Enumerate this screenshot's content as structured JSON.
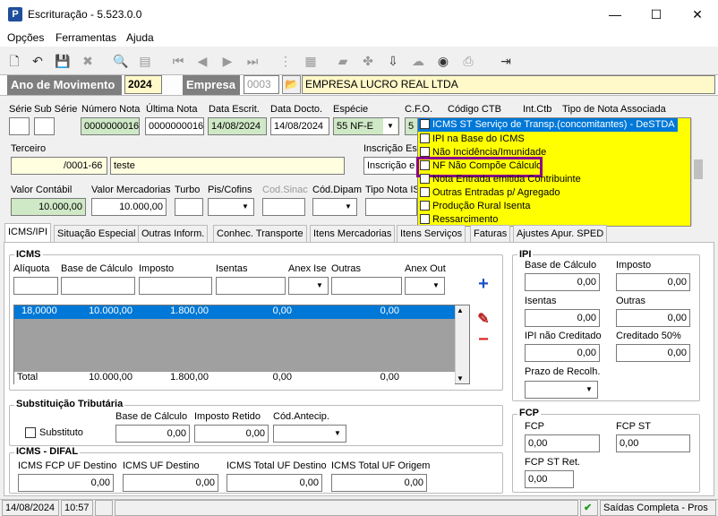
{
  "window": {
    "title": "Escrituração - 5.523.0.0",
    "minimize": "—",
    "maximize": "☐",
    "close": "✕"
  },
  "menu": [
    "Opções",
    "Ferramentas",
    "Ajuda"
  ],
  "header": {
    "ano_label": "Ano de Movimento",
    "ano_value": "2024",
    "empresa_label": "Empresa",
    "empresa_code": "0003",
    "empresa_name": "EMPRESA LUCRO REAL LTDA"
  },
  "doc": {
    "serie_label": "Série",
    "subserie_label": "Sub Série",
    "numero_label": "Número Nota",
    "numero_value": "0000000016",
    "ultima_label": "Última Nota",
    "ultima_value": "0000000016",
    "escrit_label": "Data Escrit.",
    "escrit_value": "14/08/2024",
    "docto_label": "Data Docto.",
    "docto_value": "14/08/2024",
    "especie_label": "Espécie",
    "especie_value": "55   NF-E",
    "cfo_label": "C.F.O.",
    "cfo_value": "5",
    "ctb_label": "Código CTB",
    "intctb_label": "Int.Ctb",
    "tiponota_label": "Tipo de Nota Associada"
  },
  "terceiro": {
    "label": "Terceiro",
    "cnpj": "/0001-66",
    "name": "teste",
    "inscricao_label": "Inscrição Es",
    "inscricao_value": "Inscrição e"
  },
  "valores": {
    "contabil_label": "Valor Contábil",
    "contabil_value": "10.000,00",
    "mercadorias_label": "Valor Mercadorias",
    "mercadorias_value": "10.000,00",
    "turbo_label": "Turbo",
    "piscofins_label": "Pis/Cofins",
    "codsinac_label": "Cod.Sinac",
    "coddipam_label": "Cód.Dipam",
    "tiponota_label": "Tipo Nota IS"
  },
  "tipo_nota_list": [
    "ICMS ST Serviço de Transp.(concomitantes) - DeSTDA",
    "IPI na Base do ICMS",
    "Não Incidência/Imunidade",
    "NF Não Compõe Cálculo",
    "Nota Entrada emitida Contribuinte",
    "Outras Entradas p/ Agregado",
    "Produção Rural Isenta",
    "Ressarcimento"
  ],
  "tabs": [
    "ICMS/IPI",
    "Situação Especial",
    "Outras Inform.",
    "Conhec. Transporte",
    "Itens Mercadorias",
    "Itens Serviços",
    "Faturas",
    "Ajustes Apur. SPED"
  ],
  "icms": {
    "title": "ICMS",
    "cols": [
      "Alíquota",
      "Base de Cálculo",
      "Imposto",
      "Isentas",
      "Anex Ise",
      "Outras",
      "Anex Out"
    ],
    "row": [
      "18,0000",
      "10.000,00",
      "1.800,00",
      "0,00",
      "0,00"
    ],
    "total": [
      "Total",
      "10.000,00",
      "1.800,00",
      "0,00",
      "0,00"
    ]
  },
  "st": {
    "title": "Substituição Tributária",
    "substituto_label": "Substituto",
    "base_label": "Base de Cálculo",
    "base_value": "0,00",
    "retido_label": "Imposto Retido",
    "retido_value": "0,00",
    "antecip_label": "Cód.Antecip."
  },
  "difal": {
    "title": "ICMS - DIFAL",
    "fcp_label": "ICMS FCP UF Destino",
    "fcp_value": "0,00",
    "destino_label": "ICMS UF Destino",
    "destino_value": "0,00",
    "total_destino_label": "ICMS Total UF Destino",
    "total_destino_value": "0,00",
    "total_origem_label": "ICMS Total UF Origem",
    "total_origem_value": "0,00"
  },
  "ipi": {
    "title": "IPI",
    "base_label": "Base de Cálculo",
    "base_value": "0,00",
    "imposto_label": "Imposto",
    "imposto_value": "0,00",
    "isentas_label": "Isentas",
    "isentas_value": "0,00",
    "outras_label": "Outras",
    "outras_value": "0,00",
    "naocred_label": "IPI não Creditado",
    "naocred_value": "0,00",
    "cred50_label": "Creditado 50%",
    "cred50_value": "0,00",
    "prazo_label": "Prazo de Recolh."
  },
  "fcp": {
    "title": "FCP",
    "fcp_label": "FCP",
    "fcp_value": "0,00",
    "st_label": "FCP ST",
    "st_value": "0,00",
    "stret_label": "FCP ST Ret.",
    "stret_value": "0,00"
  },
  "status": {
    "date": "14/08/2024",
    "time": "10:57",
    "mode": "Saídas Completa - Pros"
  },
  "colors": {
    "highlight": "#0078d7",
    "yellow": "#ffff00",
    "green_input": "#cfe8c6",
    "purple_border": "#8b008b"
  }
}
